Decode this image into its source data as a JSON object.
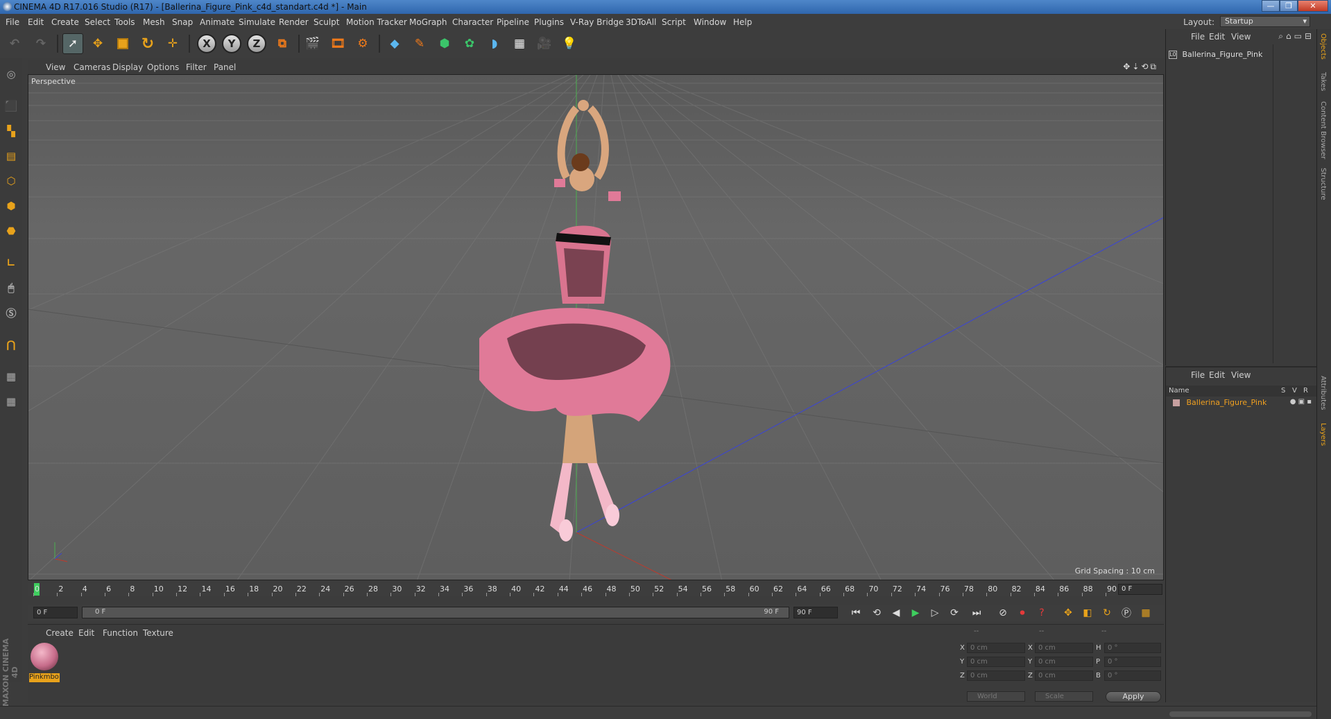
{
  "window": {
    "title": "CINEMA 4D R17.016 Studio (R17) - [Ballerina_Figure_Pink_c4d_standart.c4d *] - Main",
    "buttons": [
      "—",
      "❐",
      "✕"
    ]
  },
  "menubar": {
    "items": [
      "File",
      "Edit",
      "Create",
      "Select",
      "Tools",
      "Mesh",
      "Snap",
      "Animate",
      "Simulate",
      "Render",
      "Sculpt",
      "Motion Tracker",
      "MoGraph",
      "Character",
      "Pipeline",
      "Plugins",
      "V-Ray Bridge",
      "3DToAll",
      "Script",
      "Window",
      "Help"
    ],
    "layout_label": "Layout:",
    "layout_value": "Startup"
  },
  "toolbar": {
    "axis_x": "X",
    "axis_y": "Y",
    "axis_z": "Z"
  },
  "viewport": {
    "menu": [
      "View",
      "Cameras",
      "Display",
      "Options",
      "Filter",
      "Panel"
    ],
    "label": "Perspective",
    "grid_spacing": "Grid Spacing : 10 cm"
  },
  "timeline": {
    "ticks": [
      "0",
      "2",
      "4",
      "6",
      "8",
      "10",
      "12",
      "14",
      "16",
      "18",
      "20",
      "22",
      "24",
      "26",
      "28",
      "30",
      "32",
      "34",
      "36",
      "38",
      "40",
      "42",
      "44",
      "46",
      "48",
      "50",
      "52",
      "54",
      "56",
      "58",
      "60",
      "62",
      "64",
      "66",
      "68",
      "70",
      "72",
      "74",
      "76",
      "78",
      "80",
      "82",
      "84",
      "86",
      "88",
      "90"
    ],
    "current_frame": "0 F"
  },
  "transport": {
    "start_field": "0 F",
    "slider_start": "0 F",
    "slider_end": "90 F",
    "end_field": "90 F"
  },
  "material_panel": {
    "menu": [
      "Create",
      "Edit",
      "Function",
      "Texture"
    ],
    "material_name": "Pinkmbo"
  },
  "coordinates": {
    "header": [
      "--",
      "--",
      "--"
    ],
    "rows": [
      {
        "l1": "X",
        "v1": "0 cm",
        "l2": "X",
        "v2": "0 cm",
        "l3": "H",
        "v3": "0 °"
      },
      {
        "l1": "Y",
        "v1": "0 cm",
        "l2": "Y",
        "v2": "0 cm",
        "l3": "P",
        "v3": "0 °"
      },
      {
        "l1": "Z",
        "v1": "0 cm",
        "l2": "Z",
        "v2": "0 cm",
        "l3": "B",
        "v3": "0 °"
      }
    ],
    "world": "World",
    "scale": "Scale",
    "apply": "Apply"
  },
  "objects_panel": {
    "menu": [
      "File",
      "Edit",
      "View"
    ],
    "object_name": "Ballerina_Figure_Pink"
  },
  "layers_panel": {
    "menu": [
      "File",
      "Edit",
      "View"
    ],
    "col_name": "Name",
    "col_s": "S",
    "col_v": "V",
    "col_r": "R",
    "layer_name": "Ballerina_Figure_Pink"
  },
  "right_tabs": [
    "Objects",
    "Takes",
    "Content Browser",
    "Structure",
    "Attributes",
    "Layers"
  ],
  "branding": "MAXON CINEMA 4D",
  "colors": {
    "accent": "#e8a21b",
    "play": "#3ece5e",
    "tutu_pink": "#e07a98"
  }
}
